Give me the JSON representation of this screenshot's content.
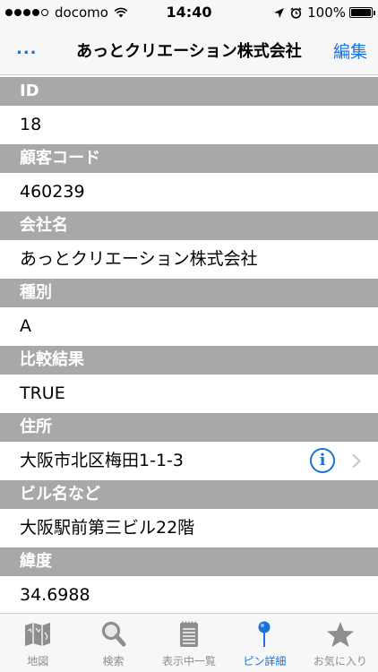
{
  "status_bar": {
    "carrier": "docomo",
    "time": "14:40",
    "battery": "100%"
  },
  "nav": {
    "more_label": "...",
    "title": "あっとクリエーション株式会社",
    "edit_label": "編集"
  },
  "fields": [
    {
      "label": "ID",
      "value": "18"
    },
    {
      "label": "顧客コード",
      "value": "460239"
    },
    {
      "label": "会社名",
      "value": "あっとクリエーション株式会社"
    },
    {
      "label": "種別",
      "value": "A"
    },
    {
      "label": "比較結果",
      "value": "TRUE"
    },
    {
      "label": "住所",
      "value": "大阪市北区梅田1-1-3"
    },
    {
      "label": "ビル名など",
      "value": "大阪駅前第三ビル22階"
    },
    {
      "label": "緯度",
      "value": "34.6988"
    }
  ],
  "tabs": [
    {
      "label": "地図",
      "icon": "map-icon",
      "active": false
    },
    {
      "label": "検索",
      "icon": "magnifier-icon",
      "active": false
    },
    {
      "label": "表示中一覧",
      "icon": "notepad-icon",
      "active": false
    },
    {
      "label": "ピン詳細",
      "icon": "pin-icon",
      "active": true
    },
    {
      "label": "お気に入り",
      "icon": "star-icon",
      "active": false
    }
  ],
  "colors": {
    "accent": "#1a73d9",
    "section_header": "#a8a8a8",
    "bar_background": "#f7f7f7"
  }
}
